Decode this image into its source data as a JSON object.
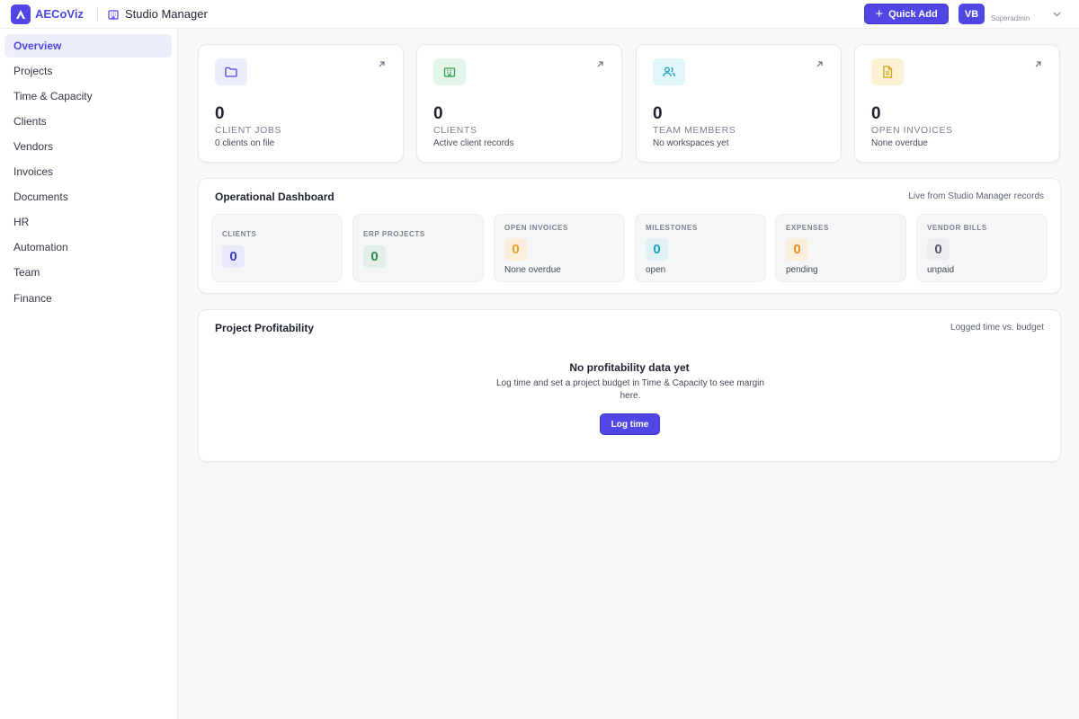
{
  "app": {
    "brand": "AECoViz",
    "module_title": "Studio Manager"
  },
  "header": {
    "quick_add_label": "Quick Add",
    "avatar_initials": "VB",
    "role": "Superadmin"
  },
  "sidebar": {
    "items": [
      {
        "label": "Overview",
        "active": true
      },
      {
        "label": "Projects"
      },
      {
        "label": "Time & Capacity"
      },
      {
        "label": "Clients"
      },
      {
        "label": "Vendors"
      },
      {
        "label": "Invoices"
      },
      {
        "label": "Documents"
      },
      {
        "label": "HR"
      },
      {
        "label": "Automation"
      },
      {
        "label": "Team"
      },
      {
        "label": "Finance"
      }
    ]
  },
  "stats": [
    {
      "value": "0",
      "label": "CLIENT JOBS",
      "sub": "0 clients on file",
      "icon": "folder-icon",
      "color": "#4f46e5",
      "bg": "#eceefc"
    },
    {
      "value": "0",
      "label": "CLIENTS",
      "sub": "Active client records",
      "icon": "building-icon",
      "color": "#2f9e58",
      "bg": "#e4f6ea"
    },
    {
      "value": "0",
      "label": "TEAM MEMBERS",
      "sub": "No workspaces yet",
      "icon": "users-icon",
      "color": "#1aa3c4",
      "bg": "#e1f5fa"
    },
    {
      "value": "0",
      "label": "OPEN INVOICES",
      "sub": "None overdue",
      "icon": "document-icon",
      "color": "#d4a017",
      "bg": "#fdf3d4"
    }
  ],
  "operational": {
    "title": "Operational Dashboard",
    "note": "Live from Studio Manager records",
    "items": [
      {
        "label": "CLIENTS",
        "value": "0",
        "sub": "",
        "color": "#4338ca",
        "bg": "#e8eafb"
      },
      {
        "label": "ERP PROJECTS",
        "value": "0",
        "sub": "",
        "color": "#2f8a4c",
        "bg": "#e2efe6"
      },
      {
        "label": "OPEN INVOICES",
        "value": "0",
        "sub": "None overdue",
        "color": "#e5a22a",
        "bg": "#fbefdc"
      },
      {
        "label": "MILESTONES",
        "value": "0",
        "sub": "open",
        "color": "#1aa3c4",
        "bg": "#e1f1f5"
      },
      {
        "label": "EXPENSES",
        "value": "0",
        "sub": "pending",
        "color": "#e58f2a",
        "bg": "#fbeedd"
      },
      {
        "label": "VENDOR BILLS",
        "value": "0",
        "sub": "unpaid",
        "color": "#555b68",
        "bg": "#eceef1"
      }
    ]
  },
  "profitability": {
    "title": "Project Profitability",
    "note": "Logged time vs. budget",
    "empty_title": "No profitability data yet",
    "empty_desc": "Log time and set a project budget in Time & Capacity to see margin here.",
    "button_label": "Log time"
  }
}
